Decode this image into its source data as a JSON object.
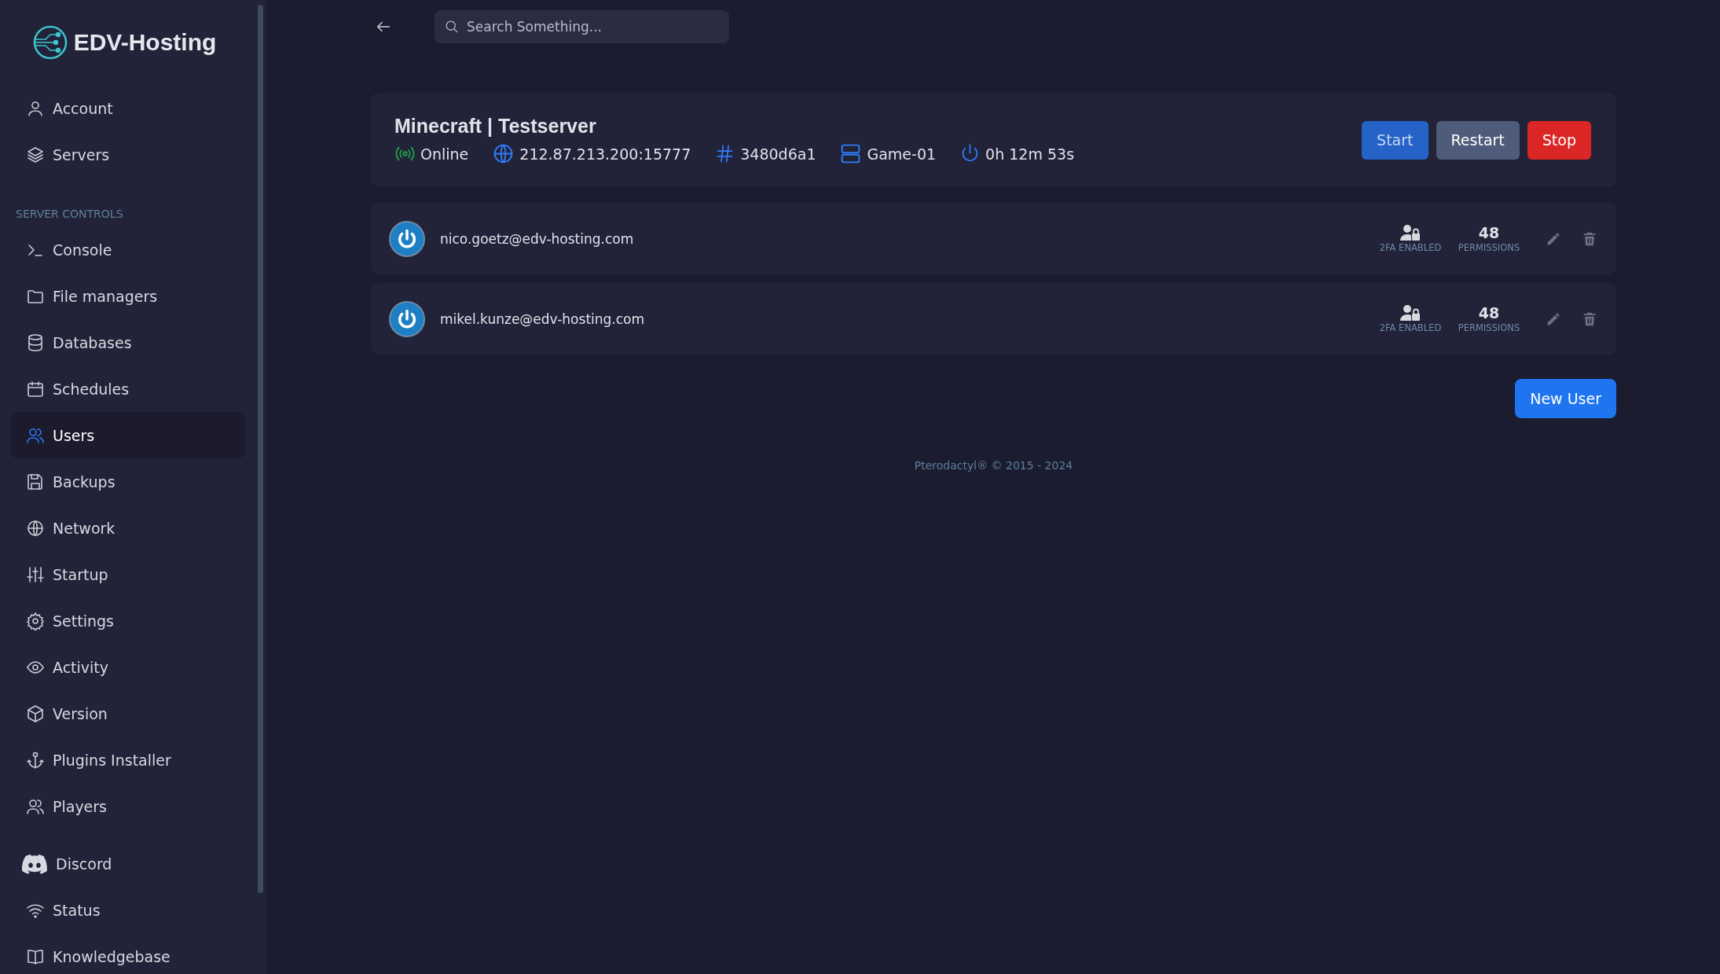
{
  "sidebar": {
    "brand": "EDV-Hosting",
    "top_items": [
      {
        "label": "Account",
        "selected": false
      },
      {
        "label": "Servers",
        "selected": false
      }
    ],
    "section_title": "SERVER CONTROLS",
    "items": [
      {
        "label": "Console",
        "selected": false
      },
      {
        "label": "File managers",
        "selected": false
      },
      {
        "label": "Databases",
        "selected": false
      },
      {
        "label": "Schedules",
        "selected": false
      },
      {
        "label": "Users",
        "selected": true
      },
      {
        "label": "Backups",
        "selected": false
      },
      {
        "label": "Network",
        "selected": false
      },
      {
        "label": "Startup",
        "selected": false
      },
      {
        "label": "Settings",
        "selected": false
      },
      {
        "label": "Activity",
        "selected": false
      },
      {
        "label": "Version",
        "selected": false
      },
      {
        "label": "Plugins Installer",
        "selected": false
      },
      {
        "label": "Players",
        "selected": false
      }
    ],
    "links": [
      {
        "label": "Discord"
      },
      {
        "label": "Status"
      },
      {
        "label": "Knowledgebase"
      }
    ]
  },
  "search": {
    "placeholder": "Search Something..."
  },
  "server": {
    "title": "Minecraft | Testserver",
    "status": {
      "text": "Online",
      "online": true
    },
    "address": "212.87.213.200:15777",
    "id": "3480d6a1",
    "node": "Game-01",
    "uptime": "0h 12m 53s",
    "buttons": [
      {
        "label": "Start",
        "kind": "start"
      },
      {
        "label": "Restart",
        "kind": "restart"
      },
      {
        "label": "Stop",
        "kind": "stop"
      }
    ]
  },
  "users": [
    {
      "email": "nico.goetz@edv-hosting.com",
      "twofa": "2FA ENABLED",
      "permissions": "48",
      "permissions_label": "PERMISSIONS"
    },
    {
      "email": "mikel.kunze@edv-hosting.com",
      "twofa": "2FA ENABLED",
      "permissions": "48",
      "permissions_label": "PERMISSIONS"
    }
  ],
  "new_user_button": "New User",
  "footer": "Pterodactyl® © 2015 - 2024"
}
